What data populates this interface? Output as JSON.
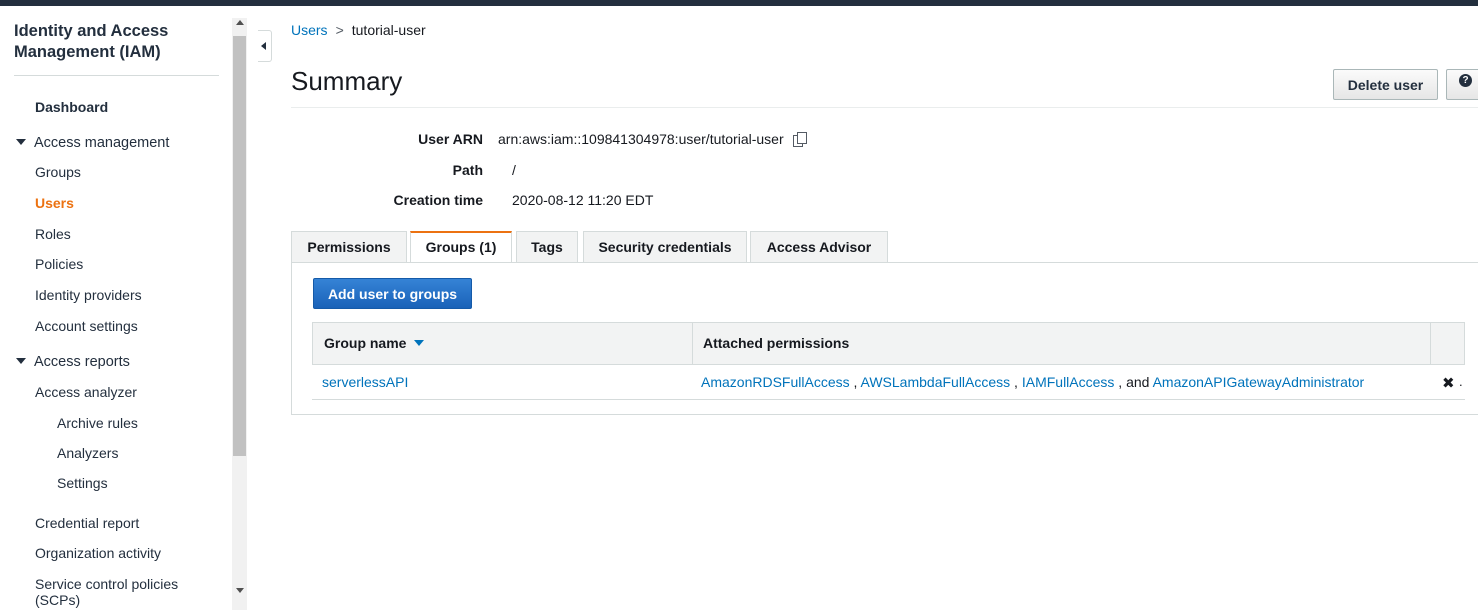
{
  "sidebar": {
    "title": "Identity and Access Management (IAM)",
    "dashboard": "Dashboard",
    "access_management": {
      "label": "Access management",
      "items": [
        "Groups",
        "Users",
        "Roles",
        "Policies",
        "Identity providers",
        "Account settings"
      ],
      "active": "Users"
    },
    "access_reports": {
      "label": "Access reports",
      "analyzer": "Access analyzer",
      "analyzer_items": [
        "Archive rules",
        "Analyzers",
        "Settings"
      ],
      "items": [
        "Credential report",
        "Organization activity",
        "Service control policies (SCPs)"
      ]
    }
  },
  "breadcrumb": {
    "parent": "Users",
    "separator": ">",
    "current": "tutorial-user"
  },
  "header": {
    "title": "Summary",
    "delete_button": "Delete user",
    "help_icon": "question-circle"
  },
  "summary": {
    "user_arn_label": "User ARN",
    "user_arn_value": "arn:aws:iam::109841304978:user/tutorial-user",
    "path_label": "Path",
    "path_value": "/",
    "creation_time_label": "Creation time",
    "creation_time_value": "2020-08-12 11:20 EDT"
  },
  "tabs": [
    "Permissions",
    "Groups (1)",
    "Tags",
    "Security credentials",
    "Access Advisor"
  ],
  "active_tab": "Groups (1)",
  "groups_panel": {
    "add_button": "Add user to groups",
    "columns": [
      "Group name",
      "Attached permissions"
    ],
    "rows": [
      {
        "group_name": "serverlessAPI",
        "permissions": [
          "AmazonRDSFullAccess",
          "AWSLambdaFullAccess",
          "IAMFullAccess",
          "AmazonAPIGatewayAdministrator"
        ],
        "sep1": " , ",
        "sep2": " , ",
        "sep3": " , and "
      }
    ]
  },
  "colors": {
    "accent": "#ec7211",
    "link": "#0073bb",
    "primary_button": "#1a62b8",
    "nav_dark": "#232f3e"
  }
}
